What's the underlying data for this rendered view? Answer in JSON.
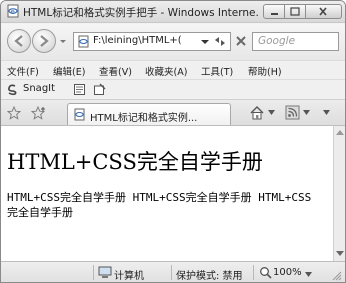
{
  "window": {
    "title": "HTML标记和格式实例手把手 - Windows Interne..."
  },
  "address_bar": {
    "url": "F:\\leining\\HTML+(",
    "search_placeholder": "Google"
  },
  "menu": {
    "items": [
      "文件(F)",
      "编辑(E)",
      "查看(V)",
      "收藏夹(A)",
      "工具(T)",
      "帮助(H)"
    ]
  },
  "snagit_toolbar": {
    "label": "SnagIt"
  },
  "tab": {
    "label": "HTML标记和格式实例..."
  },
  "page": {
    "heading": "HTML+CSS完全自学手册",
    "body_text": "HTML+CSS完全自学手册 HTML+CSS完全自学手册 HTML+CSS完全自学手册"
  },
  "status_bar": {
    "zone": "计算机",
    "protected_mode": "保护模式: 禁用",
    "zoom": "100%"
  },
  "icons": {
    "back": "back-arrow-icon",
    "forward": "forward-arrow-icon",
    "refresh": "refresh-icon",
    "stop": "stop-icon",
    "favorites": "favorites-star-icon",
    "add_favorite": "add-favorite-icon",
    "home": "home-icon",
    "feeds": "feeds-icon",
    "page": "ie-page-icon"
  }
}
